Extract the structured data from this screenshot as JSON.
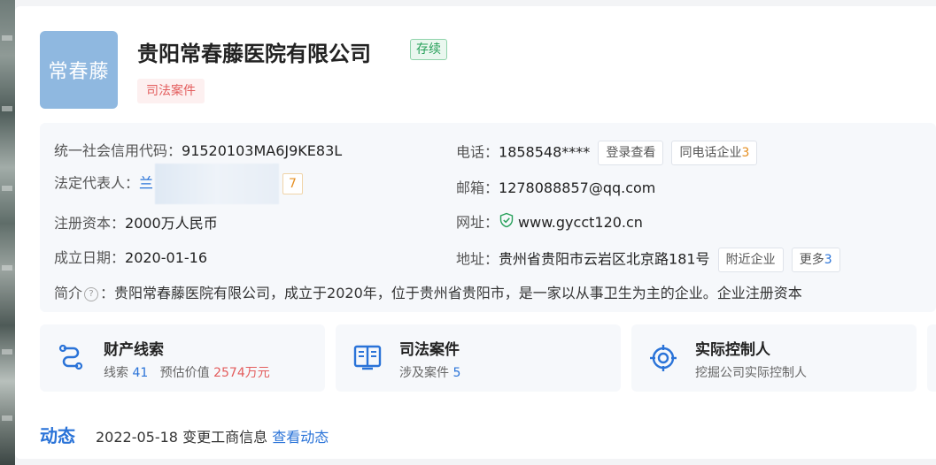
{
  "company": {
    "logo_text": "常春藤",
    "name": "贵阳常春藤医院有限公司",
    "status": "存续",
    "tag": "司法案件"
  },
  "info": {
    "credit_code_label": "统一社会信用代码：",
    "credit_code": "91520103MA6J9KE83L",
    "legal_rep_label": "法定代表人：",
    "legal_rep": "兰",
    "legal_rep_count": "7",
    "capital_label": "注册资本：",
    "capital": "2000万人民币",
    "founded_label": "成立日期：",
    "founded": "2020-01-16",
    "phone_label": "电话：",
    "phone": "1858548****",
    "phone_login_button": "登录查看",
    "same_phone_button": "同电话企业",
    "same_phone_count": "3",
    "email_label": "邮箱：",
    "email": "1278088857@qq.com",
    "website_label": "网址：",
    "website": "www.gycct120.cn",
    "address_label": "地址：",
    "address": "贵州省贵阳市云岩区北京路181号",
    "nearby_button": "附近企业",
    "more_button": "更多",
    "more_count": "3",
    "intro_label": "简介",
    "intro_colon": "：",
    "intro": "贵阳常春藤医院有限公司，成立于2020年，位于贵州省贵阳市，是一家以从事卫生为主的企业。企业注册资本"
  },
  "features": [
    {
      "icon": "route-icon",
      "title": "财产线索",
      "sub_prefix": "线索",
      "sub_value": "41",
      "sub_mid": "预估价值",
      "sub_value2": "2574万元"
    },
    {
      "icon": "book-icon",
      "title": "司法案件",
      "sub_prefix": "涉及案件",
      "sub_value": "5"
    },
    {
      "icon": "target-icon",
      "title": "实际控制人",
      "sub_prefix": "挖掘公司实际控制人"
    }
  ],
  "dynamics": {
    "title": "动态",
    "date": "2022-05-18",
    "event": "变更工商信息",
    "link": "查看动态"
  },
  "colors": {
    "accent": "#2a73d8",
    "status_green": "#27a05a",
    "warning_red": "#e35d5d",
    "count_orange": "#e58f22"
  }
}
